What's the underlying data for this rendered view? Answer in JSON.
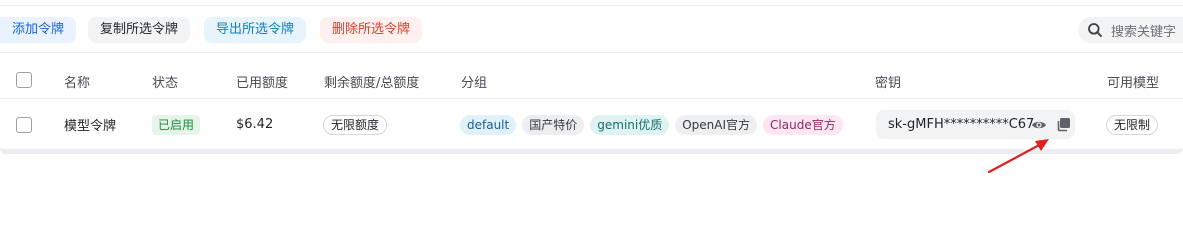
{
  "toolbar": {
    "add_label": "添加令牌",
    "copy_label": "复制所选令牌",
    "export_label": "导出所选令牌",
    "delete_label": "删除所选令牌"
  },
  "search": {
    "placeholder": "搜索关键字",
    "icon": "search-icon"
  },
  "table": {
    "columns": [
      "名称",
      "状态",
      "已用额度",
      "剩余额度/总额度",
      "分组",
      "密钥",
      "可用模型"
    ],
    "rows": [
      {
        "name": "模型令牌",
        "status": "已启用",
        "used": "$6.42",
        "remaining": "无限额度",
        "groups": [
          "default",
          "国产特价",
          "gemini优质",
          "OpenAI官方",
          "Claude官方"
        ],
        "key": "sk-gMFH**********C67",
        "models": "无限制"
      }
    ]
  },
  "colors": {
    "add": "#1664d9",
    "export": "#0b7fc4",
    "delete": "#d6412b",
    "status_enabled": "#1f8a3b",
    "annotation_arrow": "#e02020"
  },
  "icons": [
    "search-icon",
    "eye-icon",
    "copy-icon",
    "arrow-annotation"
  ]
}
